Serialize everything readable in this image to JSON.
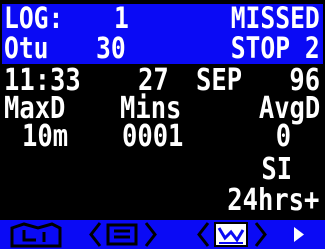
{
  "header": {
    "log_label": "LOG:",
    "log_number": "1",
    "status": "MISSED",
    "otu_label": "Otu",
    "otu_value": "30",
    "stop_label": "STOP 2"
  },
  "datetime": {
    "time": "11:33",
    "day": "27",
    "month": "SEP",
    "year": "96"
  },
  "stats": {
    "maxd_label": "MaxD",
    "mins_label": "Mins",
    "avgd_label": "AvgD",
    "maxd_value": "10m",
    "mins_value": "0001",
    "avgd_value": "0"
  },
  "surface_interval": {
    "label": "SI",
    "value": "24hrs+"
  },
  "footer": {
    "icons": [
      "logbook-icon",
      "prev-arrow-icon",
      "list-icon",
      "next-arrow-icon",
      "prev-arrow-icon",
      "graph-icon",
      "next-arrow-icon",
      "right-triangle-icon"
    ]
  },
  "colors": {
    "background": "#000000",
    "accent_blue": "#0A0AF5",
    "text": "#FFFFFF"
  }
}
